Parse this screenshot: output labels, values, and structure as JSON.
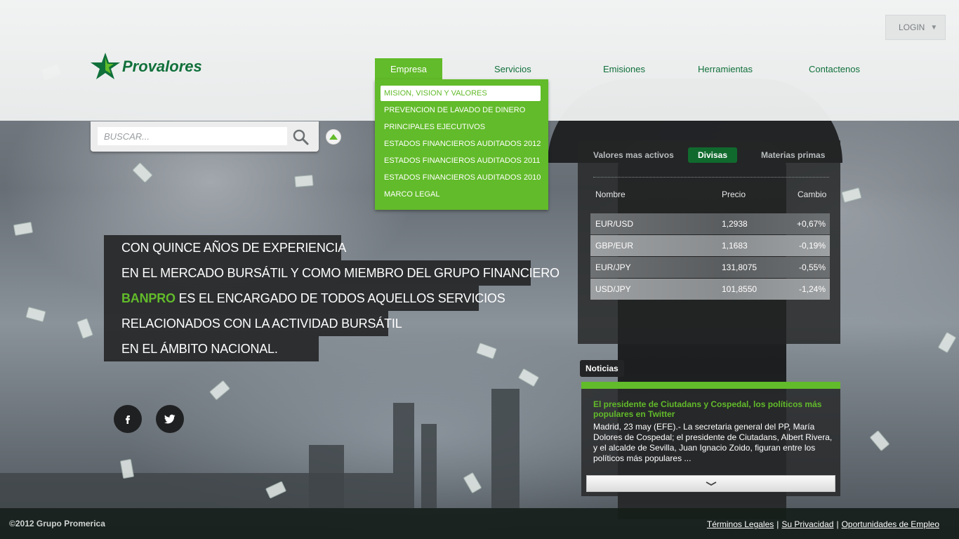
{
  "brand": {
    "name": "Provalores"
  },
  "login": {
    "label": "LOGIN"
  },
  "nav": {
    "items": [
      {
        "label": "Empresa"
      },
      {
        "label": "Servicios"
      },
      {
        "label": "Emisiones"
      },
      {
        "label": "Herramientas"
      },
      {
        "label": "Contactenos"
      }
    ],
    "dropdown": [
      {
        "label": "MISION, VISION Y VALORES"
      },
      {
        "label": "PREVENCION DE LAVADO DE DINERO"
      },
      {
        "label": "PRINCIPALES EJECUTIVOS"
      },
      {
        "label": "ESTADOS FINANCIEROS AUDITADOS 2012"
      },
      {
        "label": "ESTADOS FINANCIEROS AUDITADOS 2011"
      },
      {
        "label": "ESTADOS FINANCIEROS AUDITADOS 2010"
      },
      {
        "label": "MARCO LEGAL"
      }
    ]
  },
  "search": {
    "placeholder": "BUSCAR..."
  },
  "hero": {
    "line1": "CON QUINCE AÑOS DE EXPERIENCIA",
    "line2": "EN EL MERCADO BURSÁTIL Y COMO MIEMBRO DEL GRUPO FINANCIERO",
    "line3_accent": "BANPRO",
    "line3_rest": " ES EL ENCARGADO DE TODOS AQUELLOS SERVICIOS",
    "line4": "RELACIONADOS CON LA ACTIVIDAD BURSÁTIL",
    "line5": "EN EL ÁMBITO NACIONAL."
  },
  "market": {
    "tabs": [
      "Valores mas activos",
      "Divisas",
      "Materias primas"
    ],
    "headers": {
      "name": "Nombre",
      "price": "Precio",
      "change": "Cambio"
    },
    "rows": [
      {
        "name": "EUR/USD",
        "price": "1,2938",
        "change": "+0,67%"
      },
      {
        "name": "GBP/EUR",
        "price": "1,1683",
        "change": "-0,19%"
      },
      {
        "name": "EUR/JPY",
        "price": "131,8075",
        "change": "-0,55%"
      },
      {
        "name": "USD/JPY",
        "price": "101,8550",
        "change": "-1,24%"
      }
    ]
  },
  "news": {
    "label": "Noticias",
    "title": "El presidente de Ciutadans y Cospedal, los políticos más populares en Twitter",
    "body": "Madrid, 23 may (EFE).- La secretaria general del PP, María Dolores de Cospedal; el presidente de Ciutadans, Albert Rivera, y el alcalde de Sevilla, Juan Ignacio Zoido, figuran entre los políticos más populares ..."
  },
  "footer": {
    "copyright": "©2012 Grupo Promerica",
    "links": [
      "Términos Legales",
      "Su Privacidad",
      "Oportunidades de Empleo"
    ],
    "separator": "|"
  },
  "colors": {
    "brand_green": "#62bb2a",
    "dark_green": "#10703a"
  },
  "icons": [
    "star-logo-icon",
    "caret-down-icon",
    "search-icon",
    "chevron-up-icon",
    "facebook-icon",
    "twitter-icon",
    "chevron-down-icon"
  ]
}
